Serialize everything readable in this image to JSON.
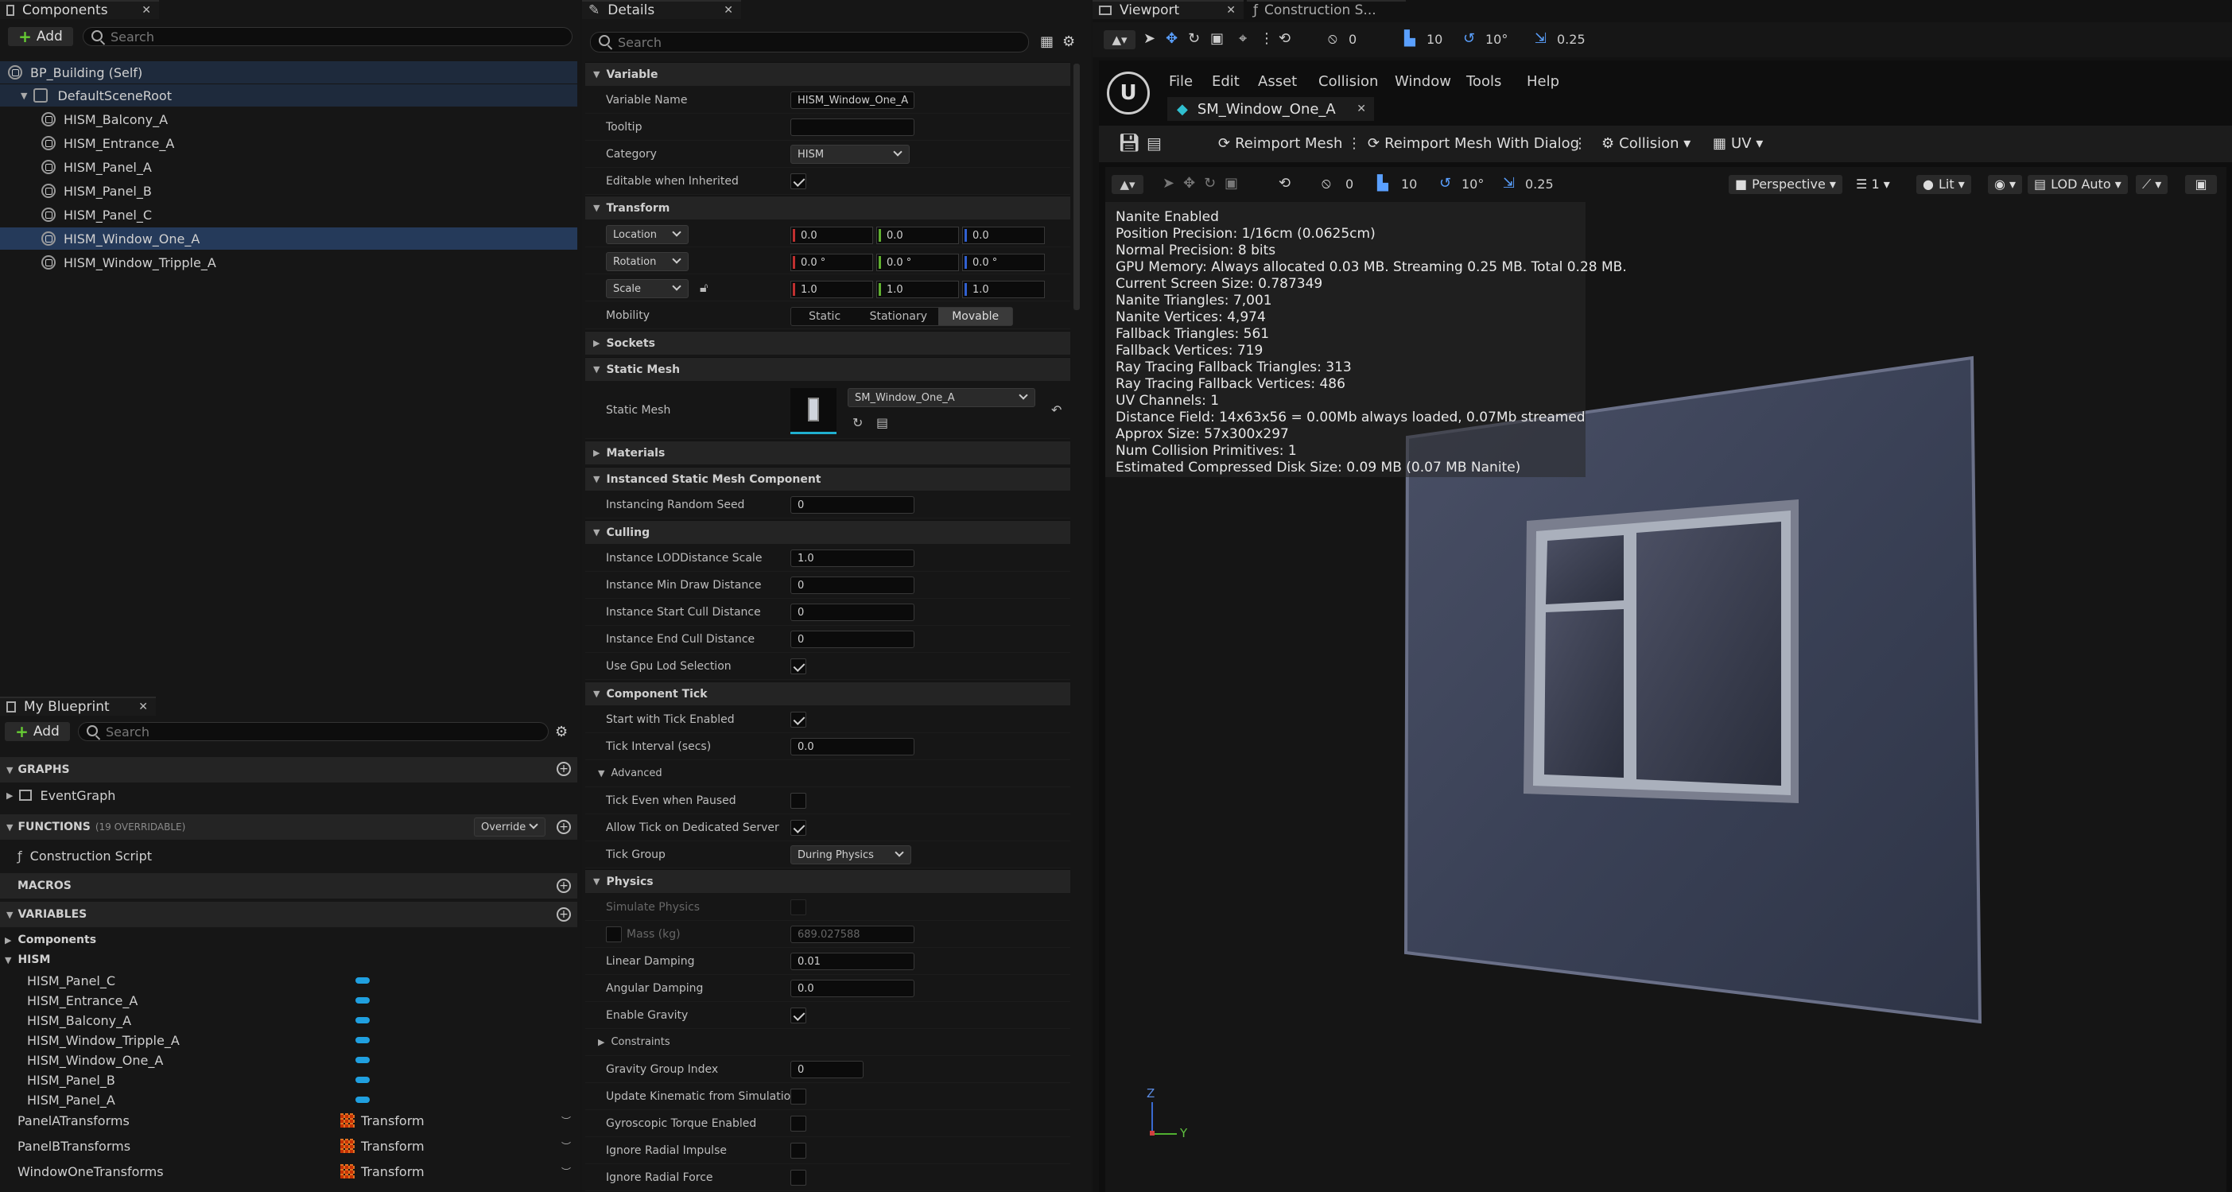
{
  "components_panel": {
    "tab": "Components",
    "add_label": "Add",
    "search_placeholder": "Search",
    "items": [
      {
        "label": "BP_Building (Self)"
      },
      {
        "label": "DefaultSceneRoot"
      },
      {
        "label": "HISM_Balcony_A"
      },
      {
        "label": "HISM_Entrance_A"
      },
      {
        "label": "HISM_Panel_A"
      },
      {
        "label": "HISM_Panel_B"
      },
      {
        "label": "HISM_Panel_C"
      },
      {
        "label": "HISM_Window_One_A"
      },
      {
        "label": "HISM_Window_Tripple_A"
      }
    ]
  },
  "my_blueprint": {
    "tab": "My Blueprint",
    "add_label": "Add",
    "search_placeholder": "Search",
    "graphs_header": "GRAPHS",
    "event_graph": "EventGraph",
    "functions_header": "FUNCTIONS",
    "functions_count": "(19 OVERRIDABLE)",
    "override_label": "Override",
    "construction_script": "Construction Script",
    "macros_header": "MACROS",
    "variables_header": "VARIABLES",
    "components_group": "Components",
    "hism_group": "HISM",
    "hism_vars": [
      "HISM_Panel_C",
      "HISM_Entrance_A",
      "HISM_Balcony_A",
      "HISM_Window_Tripple_A",
      "HISM_Window_One_A",
      "HISM_Panel_B",
      "HISM_Panel_A"
    ],
    "transform_vars": [
      {
        "name": "PanelATransforms",
        "type": "Transform"
      },
      {
        "name": "PanelBTransforms",
        "type": "Transform"
      },
      {
        "name": "WindowOneTransforms",
        "type": "Transform"
      }
    ]
  },
  "details": {
    "tab": "Details",
    "search_placeholder": "Search",
    "sec_variable": "Variable",
    "variable_name_label": "Variable Name",
    "variable_name_value": "HISM_Window_One_A",
    "tooltip_label": "Tooltip",
    "category_label": "Category",
    "category_value": "HISM",
    "editable_label": "Editable when Inherited",
    "sec_transform": "Transform",
    "location_label": "Location",
    "rotation_label": "Rotation",
    "scale_label": "Scale",
    "location": [
      "0.0",
      "0.0",
      "0.0"
    ],
    "rotation": [
      "0.0 °",
      "0.0 °",
      "0.0 °"
    ],
    "scale": [
      "1.0",
      "1.0",
      "1.0"
    ],
    "mobility_label": "Mobility",
    "mobility_static": "Static",
    "mobility_stationary": "Stationary",
    "mobility_movable": "Movable",
    "sec_sockets": "Sockets",
    "sec_static_mesh": "Static Mesh",
    "static_mesh_label": "Static Mesh",
    "static_mesh_value": "SM_Window_One_A",
    "sec_materials": "Materials",
    "sec_ismc": "Instanced Static Mesh Component",
    "random_seed_label": "Instancing Random Seed",
    "random_seed_value": "0",
    "sec_culling": "Culling",
    "lod_scale_label": "Instance LODDistance Scale",
    "lod_scale_value": "1.0",
    "min_draw_label": "Instance Min Draw Distance",
    "min_draw_value": "0",
    "start_cull_label": "Instance Start Cull Distance",
    "start_cull_value": "0",
    "end_cull_label": "Instance End Cull Distance",
    "end_cull_value": "0",
    "gpu_lod_label": "Use Gpu Lod Selection",
    "sec_tick": "Component Tick",
    "start_tick_label": "Start with Tick Enabled",
    "tick_interval_label": "Tick Interval (secs)",
    "tick_interval_value": "0.0",
    "advanced_label": "Advanced",
    "tick_paused_label": "Tick Even when Paused",
    "tick_server_label": "Allow Tick on Dedicated Server",
    "tick_group_label": "Tick Group",
    "tick_group_value": "During Physics",
    "sec_physics": "Physics",
    "simulate_label": "Simulate Physics",
    "mass_label": "Mass (kg)",
    "mass_value": "689.027588",
    "linear_damping_label": "Linear Damping",
    "linear_damping_value": "0.01",
    "angular_damping_label": "Angular Damping",
    "angular_damping_value": "0.0",
    "gravity_label": "Enable Gravity",
    "constraints_label": "Constraints",
    "gravity_group_label": "Gravity Group Index",
    "gravity_group_value": "0",
    "kinematic_label": "Update Kinematic from Simulation",
    "gyro_label": "Gyroscopic Torque Enabled",
    "radial_impulse_label": "Ignore Radial Impulse",
    "radial_force_label": "Ignore Radial Force"
  },
  "viewport": {
    "tab": "Viewport",
    "tab2": "Construction S...",
    "toolbar": {
      "rot_snap": "0",
      "grid": "10",
      "angle": "10°",
      "scale": "0.25"
    },
    "menu": [
      "File",
      "Edit",
      "Asset",
      "Collision",
      "Window",
      "Tools",
      "Help"
    ],
    "asset_tab": "SM_Window_One_A",
    "reimport": "Reimport Mesh",
    "reimport_dialog": "Reimport Mesh With Dialog",
    "collision": "Collision",
    "uv": "UV",
    "vp_toolbar": {
      "rot_snap": "0",
      "grid": "10",
      "angle": "10°",
      "scale": "0.25",
      "perspective": "Perspective",
      "lod_count": "1",
      "lit": "Lit",
      "lod": "LOD Auto"
    },
    "stats": [
      "Nanite Enabled",
      "Position Precision: 1/16cm (0.0625cm)",
      "Normal Precision: 8 bits",
      "GPU Memory: Always allocated 0.03 MB. Streaming 0.25 MB. Total 0.28 MB.",
      "Current Screen Size:  0.787349",
      "Nanite Triangles:  7,001",
      "Nanite Vertices:  4,974",
      "Fallback Triangles:  561",
      "Fallback Vertices:  719",
      "Ray Tracing Fallback Triangles:  313",
      "Ray Tracing Fallback Vertices:  486",
      "UV Channels:  1",
      "Distance Field:  14x63x56 = 0.00Mb always loaded, 0.07Mb streamed",
      "Approx Size: 57x300x297",
      "Num Collision Primitives:  1",
      "Estimated Compressed Disk Size: 0.09 MB (0.07 MB Nanite)"
    ],
    "axis_z": "Z",
    "axis_y": "Y"
  }
}
